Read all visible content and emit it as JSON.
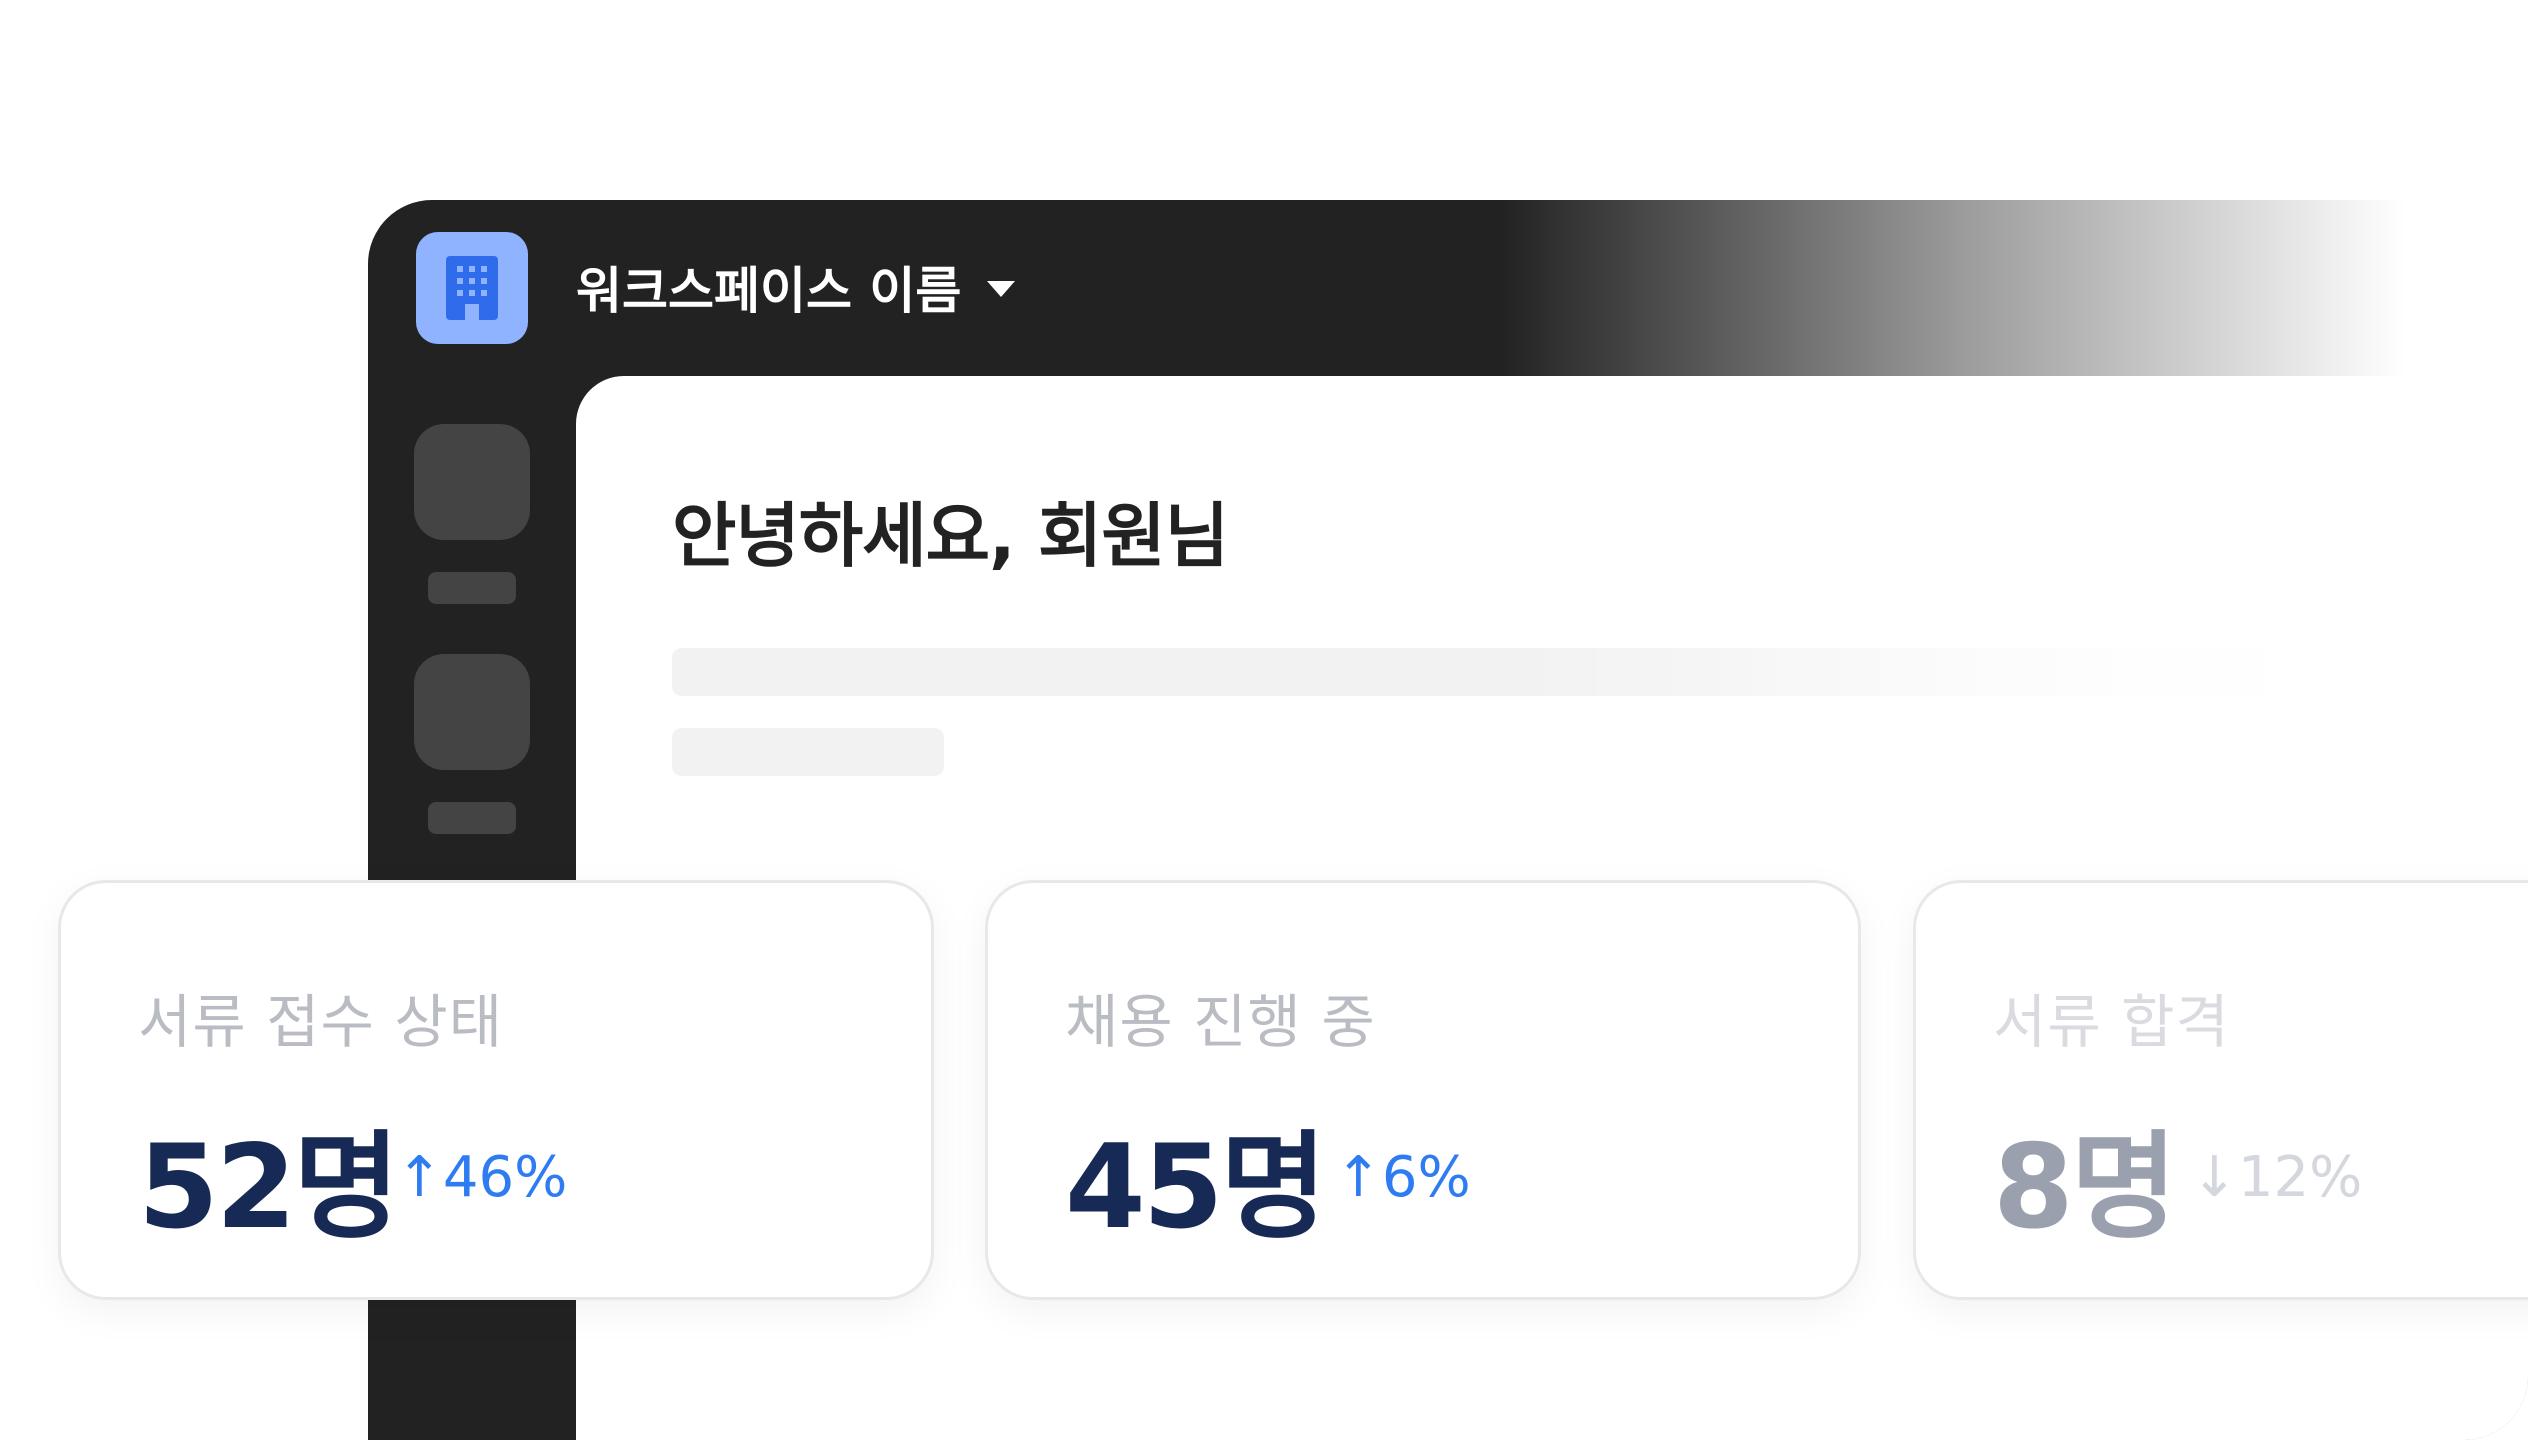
{
  "workspace": {
    "name": "워크스페이스 이름",
    "logo_icon": "building-icon",
    "dropdown_icon": "caret-down-icon",
    "logo_color": "#8fb3ff"
  },
  "greeting": "안녕하세요, 회원님",
  "stats": [
    {
      "label": "서류 접수 상태",
      "value": "52명",
      "delta": "↑46%",
      "trend": "up"
    },
    {
      "label": "채용 진행 중",
      "value": "45명",
      "delta": "↑6%",
      "trend": "up"
    },
    {
      "label": "서류 합격",
      "value": "8명",
      "delta": "↓12%",
      "trend": "down"
    }
  ],
  "colors": {
    "window_dark": "#222222",
    "value_text": "#172a55",
    "delta_up": "#2f7cf2",
    "label_text": "#b9bcc3"
  }
}
